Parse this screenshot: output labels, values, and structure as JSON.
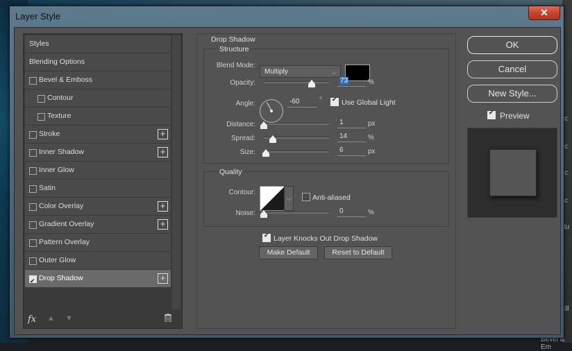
{
  "window": {
    "title": "Layer Style",
    "close_label": "✕"
  },
  "background": {
    "right_texts": [
      "c",
      "c",
      "c",
      "c",
      "xtu",
      "ill",
      "Bevel & Em"
    ]
  },
  "styles_list": {
    "items": [
      {
        "label": "Styles",
        "checkbox": false,
        "indent": 0,
        "plus": false,
        "selected": false
      },
      {
        "label": "Blending Options",
        "checkbox": false,
        "indent": 0,
        "plus": false,
        "selected": false
      },
      {
        "label": "Bevel & Emboss",
        "checkbox": true,
        "checked": false,
        "indent": 0,
        "plus": false,
        "selected": false
      },
      {
        "label": "Contour",
        "checkbox": true,
        "checked": false,
        "indent": 1,
        "plus": false,
        "selected": false
      },
      {
        "label": "Texture",
        "checkbox": true,
        "checked": false,
        "indent": 1,
        "plus": false,
        "selected": false
      },
      {
        "label": "Stroke",
        "checkbox": true,
        "checked": false,
        "indent": 0,
        "plus": true,
        "selected": false
      },
      {
        "label": "Inner Shadow",
        "checkbox": true,
        "checked": false,
        "indent": 0,
        "plus": true,
        "selected": false
      },
      {
        "label": "Inner Glow",
        "checkbox": true,
        "checked": false,
        "indent": 0,
        "plus": false,
        "selected": false
      },
      {
        "label": "Satin",
        "checkbox": true,
        "checked": false,
        "indent": 0,
        "plus": false,
        "selected": false
      },
      {
        "label": "Color Overlay",
        "checkbox": true,
        "checked": false,
        "indent": 0,
        "plus": true,
        "selected": false
      },
      {
        "label": "Gradient Overlay",
        "checkbox": true,
        "checked": false,
        "indent": 0,
        "plus": true,
        "selected": false
      },
      {
        "label": "Pattern Overlay",
        "checkbox": true,
        "checked": false,
        "indent": 0,
        "plus": false,
        "selected": false
      },
      {
        "label": "Outer Glow",
        "checkbox": true,
        "checked": false,
        "indent": 0,
        "plus": false,
        "selected": false
      },
      {
        "label": "Drop Shadow",
        "checkbox": true,
        "checked": true,
        "indent": 0,
        "plus": true,
        "selected": true
      }
    ],
    "fx_label": "fx"
  },
  "drop_shadow": {
    "title": "Drop Shadow",
    "structure": {
      "title": "Structure",
      "blend_mode_label": "Blend Mode:",
      "blend_mode_value": "Multiply",
      "shadow_color": "#000000",
      "opacity_label": "Opacity:",
      "opacity_value": "73",
      "opacity_fraction": 0.73,
      "percent_unit": "%",
      "angle_label": "Angle:",
      "angle_value": "-60",
      "degree_unit": "°",
      "use_global_light_label": "Use Global Light",
      "use_global_light": true,
      "distance_label": "Distance:",
      "distance_value": "1",
      "distance_fraction": 0.0,
      "spread_label": "Spread:",
      "spread_value": "14",
      "spread_fraction": 0.14,
      "size_label": "Size:",
      "size_value": "6",
      "size_fraction": 0.03,
      "px_unit": "px"
    },
    "quality": {
      "title": "Quality",
      "contour_label": "Contour:",
      "anti_aliased_label": "Anti-aliased",
      "anti_aliased": false,
      "noise_label": "Noise:",
      "noise_value": "0",
      "noise_fraction": 0.0
    },
    "knocks_out_label": "Layer Knocks Out Drop Shadow",
    "knocks_out": true,
    "make_default_label": "Make Default",
    "reset_default_label": "Reset to Default"
  },
  "actions": {
    "ok_label": "OK",
    "cancel_label": "Cancel",
    "new_style_label": "New Style...",
    "preview_label": "Preview",
    "preview_checked": true
  }
}
